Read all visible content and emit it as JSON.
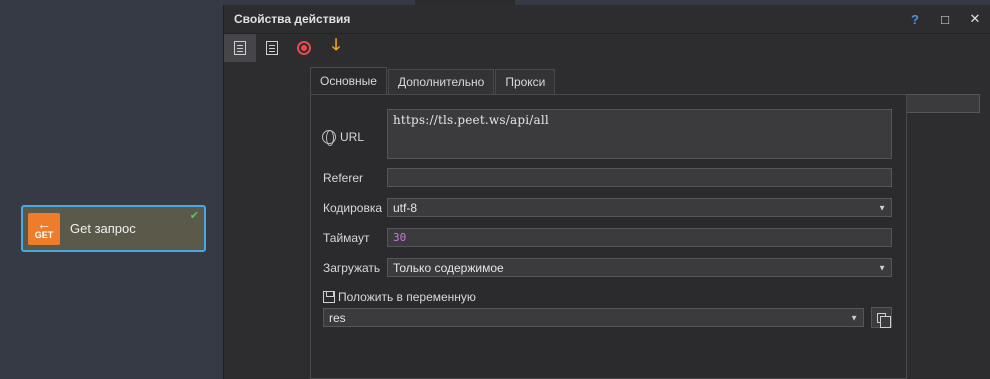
{
  "canvas": {
    "node": {
      "icon_text": "GET",
      "label": "Get запрос"
    }
  },
  "dialog": {
    "title": "Свойства действия",
    "help": "?",
    "maximize": "□",
    "close": "✕",
    "toolbar": {
      "icons": [
        "doc-settings-icon",
        "doc-edit-icon",
        "record-icon",
        "down-arrow-icon"
      ],
      "input_value": ""
    },
    "tabs": [
      {
        "label": "Основные",
        "active": true
      },
      {
        "label": "Дополнительно",
        "active": false
      },
      {
        "label": "Прокси",
        "active": false
      }
    ],
    "form": {
      "url_label": "URL",
      "url_value": "https://tls.peet.ws/api/all",
      "referer_label": "Referer",
      "referer_value": "",
      "encoding_label": "Кодировка",
      "encoding_value": "utf-8",
      "timeout_label": "Таймаут",
      "timeout_value": "30",
      "load_label": "Загружать",
      "load_value": "Только содержимое",
      "save_label": "Положить в переменную",
      "variable_value": "res"
    }
  },
  "colors": {
    "accent_blue": "#4aa8e0",
    "node_orange": "#ee7d2b",
    "record_red": "#e84a4a",
    "arrow_orange": "#f2a31c",
    "timeout_purple": "#c678dd"
  }
}
